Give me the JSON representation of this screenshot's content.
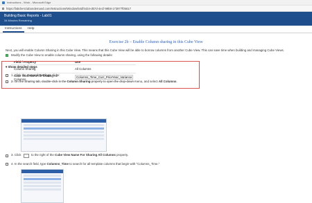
{
  "window": {
    "title": "Instructions - Work - Microsoft Edge"
  },
  "address": {
    "url": "https://labclient.labondemand.com/Instructions/Window/54df4434-d67d-4e1f-99b8-173977f05617"
  },
  "lab": {
    "title": "Building Basic Reports - Lab01",
    "remaining": "34 Minutes Remaining"
  },
  "tabs": [
    "Instructions",
    "Help"
  ],
  "exercise": {
    "title": "Exercise 2b – Enable Column sharing in this Cube View",
    "intro": "Next, you will enable Column Sharing in this Cube View. This means that this Cube View will be able to borrow columns from another Cube View. This can save time when building and managing Cube Views.",
    "modify_step": "Modify the Cube View to enable column sharing, using the following details:",
    "table": {
      "headers": [
        "Field / Property",
        "Use"
      ],
      "rows": [
        [
          "Column Sharing",
          "All Columns"
        ],
        [
          "Cube View Name for Sharing All Columns",
          "Columns_Time_Curr_PriorYear_Variance"
        ]
      ]
    }
  },
  "detailed": {
    "heading": "Show detailed steps",
    "steps": [
      {
        "prefix": "1. Click the ",
        "bold1": "General Settings",
        "mid": " slider.",
        "bold2": "",
        "suffix": ""
      },
      {
        "prefix": "2. On the Sharing tab, double-click in the ",
        "bold1": "Column Sharing",
        "mid": " property to open the drop-down menu, and select ",
        "bold2": "All Columns",
        "suffix": "."
      },
      {
        "prefix": "3. Click ",
        "bold1": "",
        "mid": " to the right of the ",
        "bold2": "Cube View Name For Sharing All Columns",
        "suffix": " property."
      },
      {
        "prefix": "4. In the search field, type ",
        "bold1": "Columns_Time",
        "mid": " to search for all template columns that begin with \"Columns_Time.\"",
        "bold2": "",
        "suffix": ""
      }
    ],
    "ellipsis": "..."
  },
  "colors": {
    "header": "#1e4e8c",
    "link": "#2d62c6",
    "highlight_border": "#d9534f",
    "check": "#2e9a45"
  }
}
